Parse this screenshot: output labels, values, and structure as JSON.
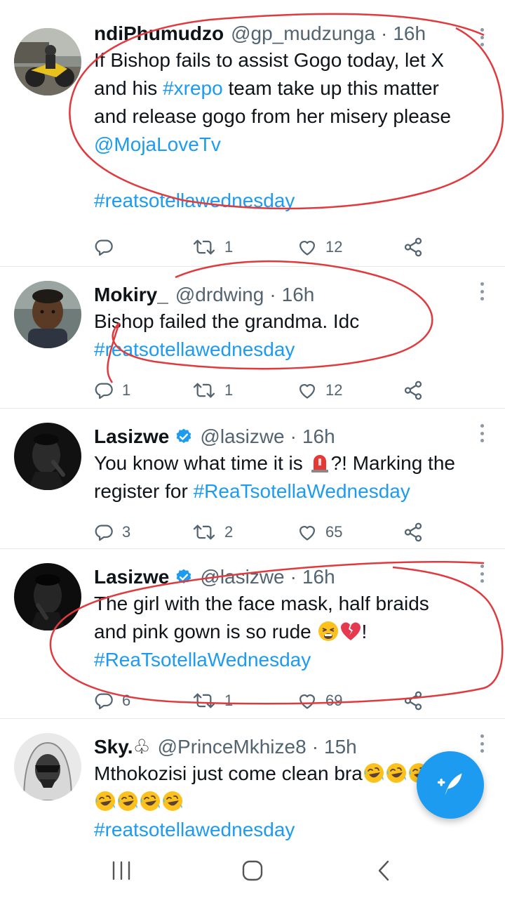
{
  "tweets": [
    {
      "name": "ndiPhumudzo",
      "handle": "@gp_mudzunga",
      "dot": "·",
      "time": "16h",
      "verified": false,
      "text_parts": [
        {
          "t": "If Bishop fails to assist Gogo today, let X\nand his ",
          "link": false
        },
        {
          "t": "#xrepo",
          "link": true
        },
        {
          "t": " team take up this matter\nand release gogo from her misery please\n",
          "link": false
        },
        {
          "t": "@MojaLoveTv",
          "link": true
        },
        {
          "t": "\n\n",
          "link": false
        },
        {
          "t": "#reatsotellawednesday",
          "link": true
        }
      ],
      "replies": "",
      "retweets": "1",
      "likes": "12"
    },
    {
      "name": "Mokiry_",
      "handle": "@drdwing",
      "dot": "·",
      "time": "16h",
      "verified": false,
      "text_parts": [
        {
          "t": "Bishop failed the grandma. Idc\n",
          "link": false
        },
        {
          "t": "#reatsotellawednesday",
          "link": true
        }
      ],
      "replies": "1",
      "retweets": "1",
      "likes": "12"
    },
    {
      "name": "Lasizwe",
      "handle": "@lasizwe",
      "dot": "·",
      "time": "16h",
      "verified": true,
      "text_parts": [
        {
          "t": "You know what time it is ",
          "link": false
        },
        {
          "emoji": "rotating-light-emoji"
        },
        {
          "t": "?! Marking the\nregister for ",
          "link": false
        },
        {
          "t": "#ReaTsotellaWednesday",
          "link": true
        }
      ],
      "replies": "3",
      "retweets": "2",
      "likes": "65"
    },
    {
      "name": "Lasizwe",
      "handle": "@lasizwe",
      "dot": "·",
      "time": "16h",
      "verified": true,
      "text_parts": [
        {
          "t": "The girl with the face mask, half braids\nand pink gown is so rude ",
          "link": false
        },
        {
          "emoji": "tired-face-emoji"
        },
        {
          "emoji": "broken-heart-emoji"
        },
        {
          "t": "!\n",
          "link": false
        },
        {
          "t": "#ReaTsotellaWednesday",
          "link": true
        }
      ],
      "replies": "6",
      "retweets": "1",
      "likes": "69"
    },
    {
      "name": "Sky.♧",
      "handle": "@PrinceMkhize8",
      "dot": "·",
      "time": "15h",
      "verified": false,
      "text_parts": [
        {
          "t": "Mthokozisi just come clean bra",
          "link": false
        },
        {
          "emoji": "rofl-emoji"
        },
        {
          "emoji": "rofl-emoji"
        },
        {
          "emoji": "rofl-emoji"
        },
        {
          "t": "\n",
          "link": false
        },
        {
          "emoji": "rofl-emoji"
        },
        {
          "emoji": "rofl-emoji"
        },
        {
          "emoji": "rofl-emoji"
        },
        {
          "emoji": "rofl-emoji"
        },
        {
          "t": "\n",
          "link": false
        },
        {
          "t": "#reatsotellawednesday",
          "link": true
        }
      ],
      "replies": "",
      "retweets": "",
      "likes": ""
    }
  ],
  "icons": {
    "reply": "reply-icon",
    "retweet": "retweet-icon",
    "like": "like-icon",
    "share": "share-icon",
    "verified": "verified-badge-icon",
    "compose": "compose-tweet-icon"
  },
  "colors": {
    "link": "#1d9bf0",
    "secondary": "#536471",
    "annotation": "#e03a3e",
    "fab": "#1d9bf0"
  },
  "system_nav": [
    "recent-apps-button",
    "home-button",
    "back-button"
  ]
}
